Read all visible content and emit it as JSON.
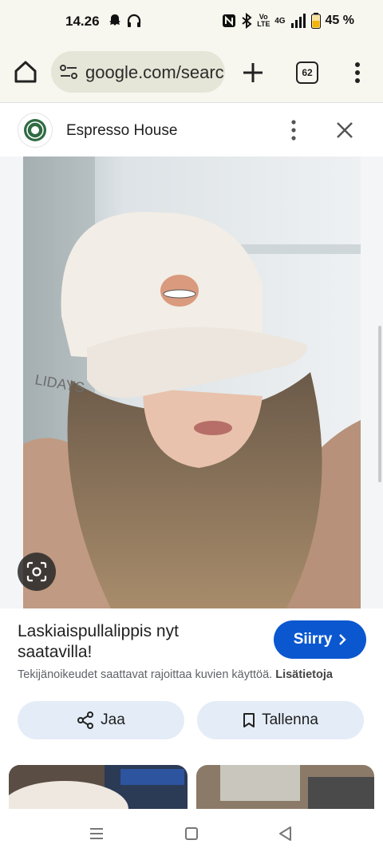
{
  "status_bar": {
    "time": "14.26",
    "network_label": "4G",
    "volte_label": "Vo LTE",
    "battery": "45 %",
    "icons": [
      "snapchat-icon",
      "headphones-icon",
      "nfc-icon",
      "bluetooth-icon",
      "volte-icon",
      "signal-icon",
      "battery-icon"
    ]
  },
  "browser": {
    "url": "google.com/search",
    "tab_count": "62",
    "icons": [
      "home-icon",
      "site-settings-icon",
      "new-tab-icon",
      "tabs-icon",
      "menu-icon"
    ]
  },
  "source": {
    "name": "Espresso House",
    "icons": [
      "more-options-icon",
      "close-icon"
    ]
  },
  "result": {
    "title": "Laskiaispullalippis nyt saatavilla!",
    "visit_label": "Siirry",
    "copyright_text": "Tekijänoikeudet saattavat rajoittaa kuvien käyttöä.",
    "learn_more": "Lisätietoja",
    "share_label": "Jaa",
    "save_label": "Tallenna"
  },
  "colors": {
    "accent": "#0b57d0",
    "chip_bg": "#e4ecf7",
    "toolbar_bg": "#f7f7ef"
  },
  "nav_bar": {
    "icons": [
      "recent-apps-icon",
      "home-nav-icon",
      "back-icon"
    ]
  }
}
